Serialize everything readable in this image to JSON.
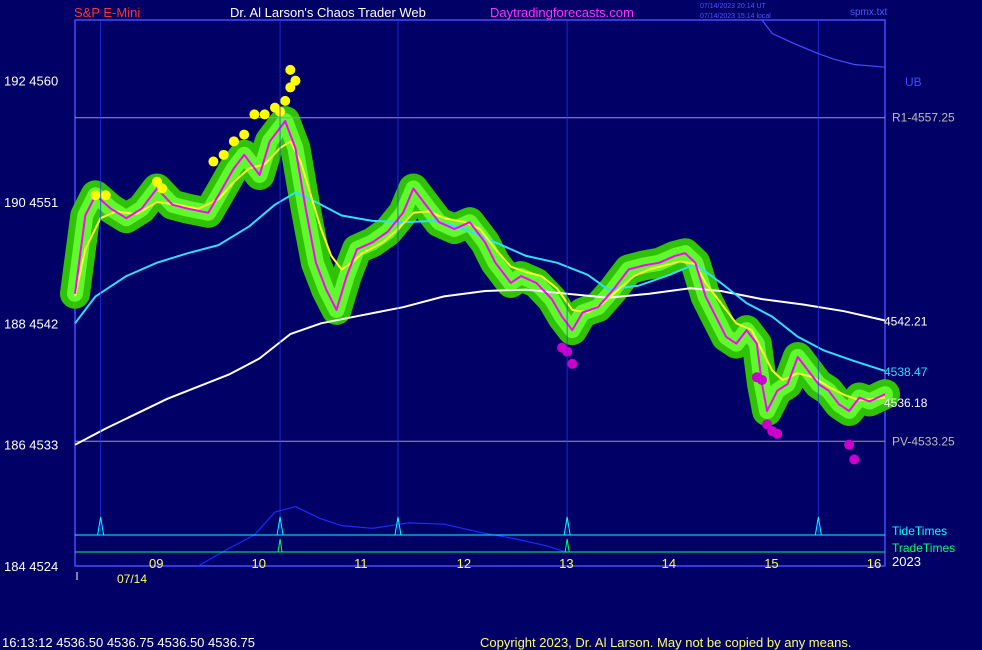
{
  "header": {
    "symbol": "S&P E-Mini",
    "title": "Dr. Al Larson's Chaos Trader Web",
    "site": "Daytradingforecasts.com",
    "stamp1": "07/14/2023 20:14 UT",
    "stamp2": "07/14/2023 15:14 local",
    "file": "spmx.txt"
  },
  "footer": {
    "quote": "16:13:12  4536.50 4536.75 4536.50 4536.75",
    "copyright": "Copyright 2023, Dr. Al Larson. May not be copied by any means."
  },
  "colors": {
    "background": "#000066",
    "frame": "#4a4aff",
    "price": "#ff00ff",
    "fast_ma": "#ffff33",
    "mid_ma": "#33ddff",
    "slow_ma": "#ffffff",
    "bands": "#33cc00",
    "tide": "#00ffff",
    "trade": "#00ff66",
    "upper_marks": "#ffff00",
    "lower_marks": "#cc00cc"
  },
  "chart_data": {
    "type": "line",
    "title": "S&P E-Mini",
    "date_label": "07/14",
    "year_label": "2023",
    "x_ticks": [
      "09",
      "10",
      "11",
      "12",
      "13",
      "14",
      "15",
      "16"
    ],
    "xlim": [
      8.2,
      16.1
    ],
    "ylim": [
      4524,
      4564.5
    ],
    "y_ticks": [
      {
        "value": 4560,
        "label": "192  4560"
      },
      {
        "value": 4551,
        "label": "190  4551"
      },
      {
        "value": 4542,
        "label": "188  4542"
      },
      {
        "value": 4533,
        "label": "186  4533"
      },
      {
        "value": 4524,
        "label": "184  4524"
      }
    ],
    "levels": [
      {
        "name": "R1",
        "label": "R1-4557.25",
        "value": 4557.25
      },
      {
        "name": "PV",
        "label": "PV-4533.25",
        "value": 4533.25
      }
    ],
    "right_labels": [
      {
        "text": "4542.21",
        "value": 4542.21,
        "color": "#ffffff"
      },
      {
        "text": "4538.47",
        "value": 4538.47,
        "color": "#33ddff"
      },
      {
        "text": "4536.18",
        "value": 4536.18,
        "color": "#ffffff"
      }
    ],
    "ub_label": "UB",
    "tide_label": "TideTimes",
    "trade_label": "TradeTimes",
    "tide_times": [
      8.45,
      10.2,
      11.35,
      13.0,
      15.45
    ],
    "trade_times": [
      10.2,
      13.0
    ],
    "series": [
      {
        "name": "price",
        "color": "#ff00ff",
        "points": [
          [
            8.2,
            4544.2
          ],
          [
            8.3,
            4550.0
          ],
          [
            8.4,
            4551.5
          ],
          [
            8.55,
            4550.5
          ],
          [
            8.7,
            4549.8
          ],
          [
            8.85,
            4550.5
          ],
          [
            9.0,
            4552.0
          ],
          [
            9.15,
            4550.8
          ],
          [
            9.3,
            4550.5
          ],
          [
            9.5,
            4550.2
          ],
          [
            9.6,
            4551.5
          ],
          [
            9.75,
            4553.5
          ],
          [
            9.85,
            4554.5
          ],
          [
            10.0,
            4553.0
          ],
          [
            10.1,
            4555.5
          ],
          [
            10.25,
            4557.0
          ],
          [
            10.35,
            4555.0
          ],
          [
            10.45,
            4550.5
          ],
          [
            10.55,
            4546.5
          ],
          [
            10.65,
            4544.5
          ],
          [
            10.75,
            4543.0
          ],
          [
            10.85,
            4545.5
          ],
          [
            10.95,
            4547.5
          ],
          [
            11.1,
            4548.0
          ],
          [
            11.25,
            4548.8
          ],
          [
            11.4,
            4550.2
          ],
          [
            11.5,
            4552.0
          ],
          [
            11.6,
            4551.0
          ],
          [
            11.75,
            4549.5
          ],
          [
            11.9,
            4549.0
          ],
          [
            12.05,
            4549.5
          ],
          [
            12.2,
            4548.0
          ],
          [
            12.3,
            4546.5
          ],
          [
            12.45,
            4545.0
          ],
          [
            12.55,
            4545.5
          ],
          [
            12.7,
            4545.0
          ],
          [
            12.85,
            4543.8
          ],
          [
            12.95,
            4542.5
          ],
          [
            13.05,
            4541.5
          ],
          [
            13.15,
            4542.8
          ],
          [
            13.3,
            4543.2
          ],
          [
            13.45,
            4544.5
          ],
          [
            13.6,
            4546.0
          ],
          [
            13.75,
            4546.3
          ],
          [
            13.9,
            4546.5
          ],
          [
            14.05,
            4547.0
          ],
          [
            14.15,
            4547.2
          ],
          [
            14.25,
            4546.5
          ],
          [
            14.35,
            4544.0
          ],
          [
            14.45,
            4542.5
          ],
          [
            14.55,
            4541.0
          ],
          [
            14.65,
            4540.5
          ],
          [
            14.75,
            4541.5
          ],
          [
            14.85,
            4540.5
          ],
          [
            14.9,
            4537.5
          ],
          [
            14.95,
            4535.5
          ],
          [
            15.05,
            4537.0
          ],
          [
            15.15,
            4537.5
          ],
          [
            15.25,
            4539.5
          ],
          [
            15.35,
            4538.5
          ],
          [
            15.45,
            4537.5
          ],
          [
            15.55,
            4537.0
          ],
          [
            15.65,
            4536.0
          ],
          [
            15.75,
            4535.5
          ],
          [
            15.85,
            4536.5
          ],
          [
            15.95,
            4536.2
          ],
          [
            16.1,
            4536.75
          ]
        ]
      },
      {
        "name": "fast",
        "color": "#ffff33",
        "points": [
          [
            8.2,
            4544.0
          ],
          [
            8.3,
            4547.5
          ],
          [
            8.45,
            4549.8
          ],
          [
            8.6,
            4550.3
          ],
          [
            8.8,
            4550.1
          ],
          [
            9.0,
            4551.0
          ],
          [
            9.2,
            4550.8
          ],
          [
            9.4,
            4550.5
          ],
          [
            9.6,
            4551.2
          ],
          [
            9.75,
            4552.5
          ],
          [
            9.9,
            4553.5
          ],
          [
            10.05,
            4553.8
          ],
          [
            10.2,
            4555.0
          ],
          [
            10.3,
            4555.5
          ],
          [
            10.4,
            4554.0
          ],
          [
            10.5,
            4551.5
          ],
          [
            10.6,
            4549.0
          ],
          [
            10.7,
            4547.0
          ],
          [
            10.8,
            4546.0
          ],
          [
            10.9,
            4546.5
          ],
          [
            11.0,
            4547.2
          ],
          [
            11.2,
            4548.0
          ],
          [
            11.35,
            4549.0
          ],
          [
            11.5,
            4550.2
          ],
          [
            11.65,
            4550.3
          ],
          [
            11.8,
            4549.8
          ],
          [
            12.0,
            4549.5
          ],
          [
            12.15,
            4549.0
          ],
          [
            12.3,
            4547.5
          ],
          [
            12.45,
            4546.2
          ],
          [
            12.6,
            4545.8
          ],
          [
            12.75,
            4545.5
          ],
          [
            12.9,
            4544.6
          ],
          [
            13.05,
            4543.0
          ],
          [
            13.2,
            4542.8
          ],
          [
            13.35,
            4543.5
          ],
          [
            13.5,
            4544.5
          ],
          [
            13.65,
            4545.5
          ],
          [
            13.8,
            4546.0
          ],
          [
            13.95,
            4546.3
          ],
          [
            14.1,
            4546.6
          ],
          [
            14.25,
            4546.4
          ],
          [
            14.35,
            4545.0
          ],
          [
            14.5,
            4543.5
          ],
          [
            14.65,
            4542.0
          ],
          [
            14.8,
            4541.5
          ],
          [
            14.9,
            4540.0
          ],
          [
            15.0,
            4538.5
          ],
          [
            15.1,
            4537.8
          ],
          [
            15.25,
            4538.3
          ],
          [
            15.4,
            4538.0
          ],
          [
            15.55,
            4537.3
          ],
          [
            15.7,
            4536.7
          ],
          [
            15.85,
            4536.3
          ],
          [
            16.0,
            4536.4
          ],
          [
            16.1,
            4536.5
          ]
        ]
      },
      {
        "name": "mid",
        "color": "#33ddff",
        "points": [
          [
            8.2,
            4542.0
          ],
          [
            8.4,
            4544.0
          ],
          [
            8.7,
            4545.5
          ],
          [
            9.0,
            4546.5
          ],
          [
            9.3,
            4547.2
          ],
          [
            9.6,
            4547.8
          ],
          [
            9.9,
            4549.2
          ],
          [
            10.15,
            4550.8
          ],
          [
            10.35,
            4551.7
          ],
          [
            10.55,
            4551.0
          ],
          [
            10.8,
            4550.0
          ],
          [
            11.1,
            4549.6
          ],
          [
            11.4,
            4549.5
          ],
          [
            11.7,
            4549.6
          ],
          [
            12.0,
            4549.0
          ],
          [
            12.3,
            4548.0
          ],
          [
            12.6,
            4547.0
          ],
          [
            12.9,
            4546.5
          ],
          [
            13.2,
            4545.6
          ],
          [
            13.4,
            4544.5
          ],
          [
            13.7,
            4544.8
          ],
          [
            14.0,
            4545.6
          ],
          [
            14.25,
            4546.4
          ],
          [
            14.5,
            4545.0
          ],
          [
            14.75,
            4543.5
          ],
          [
            15.0,
            4542.5
          ],
          [
            15.25,
            4541.0
          ],
          [
            15.5,
            4540.0
          ],
          [
            15.8,
            4539.2
          ],
          [
            16.1,
            4538.47
          ]
        ]
      },
      {
        "name": "slow",
        "color": "#ffffff",
        "points": [
          [
            8.2,
            4533.0
          ],
          [
            8.5,
            4534.2
          ],
          [
            8.8,
            4535.3
          ],
          [
            9.1,
            4536.4
          ],
          [
            9.4,
            4537.3
          ],
          [
            9.7,
            4538.2
          ],
          [
            10.0,
            4539.4
          ],
          [
            10.3,
            4541.2
          ],
          [
            10.6,
            4542.0
          ],
          [
            11.0,
            4542.6
          ],
          [
            11.4,
            4543.2
          ],
          [
            11.8,
            4544.0
          ],
          [
            12.2,
            4544.4
          ],
          [
            12.6,
            4544.5
          ],
          [
            13.0,
            4544.2
          ],
          [
            13.4,
            4543.9
          ],
          [
            13.8,
            4544.2
          ],
          [
            14.2,
            4544.6
          ],
          [
            14.5,
            4544.4
          ],
          [
            14.9,
            4543.8
          ],
          [
            15.3,
            4543.4
          ],
          [
            15.7,
            4542.9
          ],
          [
            16.1,
            4542.21
          ]
        ]
      },
      {
        "name": "ub",
        "color": "#4a4aff",
        "points": [
          [
            14.9,
            4564.5
          ],
          [
            15.0,
            4563.5
          ],
          [
            15.2,
            4562.8
          ],
          [
            15.45,
            4562.0
          ],
          [
            15.6,
            4561.6
          ],
          [
            15.8,
            4561.2
          ],
          [
            16.1,
            4561.0
          ]
        ]
      },
      {
        "name": "tide_wave",
        "color": "#1a2cff",
        "points": [
          [
            9.4,
            4524.0
          ],
          [
            9.7,
            4525.3
          ],
          [
            9.95,
            4526.3
          ],
          [
            10.15,
            4528.0
          ],
          [
            10.35,
            4528.4
          ],
          [
            10.6,
            4527.5
          ],
          [
            10.8,
            4527.0
          ],
          [
            11.1,
            4526.8
          ],
          [
            11.45,
            4527.2
          ],
          [
            11.8,
            4527.1
          ],
          [
            12.15,
            4526.5
          ],
          [
            12.5,
            4526.0
          ],
          [
            12.8,
            4525.5
          ],
          [
            13.0,
            4525.0
          ]
        ]
      }
    ],
    "upper_marks": [
      [
        8.4,
        4551.5
      ],
      [
        8.5,
        4551.5
      ],
      [
        9.0,
        4552.5
      ],
      [
        9.05,
        4552.0
      ],
      [
        9.55,
        4554.0
      ],
      [
        9.65,
        4554.5
      ],
      [
        9.75,
        4555.5
      ],
      [
        9.85,
        4556.0
      ],
      [
        9.95,
        4557.5
      ],
      [
        10.05,
        4557.5
      ],
      [
        10.15,
        4558.0
      ],
      [
        10.2,
        4557.7
      ],
      [
        10.25,
        4558.5
      ],
      [
        10.3,
        4559.5
      ],
      [
        10.35,
        4560.0
      ],
      [
        10.3,
        4560.8
      ]
    ],
    "lower_marks": [
      [
        12.95,
        4540.2
      ],
      [
        13.0,
        4539.9
      ],
      [
        13.05,
        4539.0
      ],
      [
        14.85,
        4538.0
      ],
      [
        14.9,
        4537.8
      ],
      [
        14.95,
        4534.5
      ],
      [
        15.0,
        4534.0
      ],
      [
        15.05,
        4533.8
      ],
      [
        15.75,
        4533.0
      ],
      [
        15.8,
        4531.9
      ]
    ]
  }
}
